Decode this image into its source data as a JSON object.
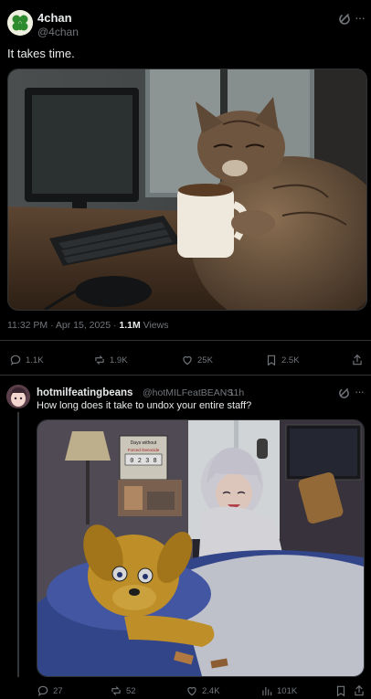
{
  "main_tweet": {
    "author_name": "4chan",
    "author_handle": "@4chan",
    "text": "It takes time.",
    "timestamp": "11:32 PM · Apr 15, 2025 · ",
    "views_count": "1.1M",
    "views_label": " Views",
    "actions": {
      "replies": "1.1K",
      "reposts": "1.9K",
      "likes": "25K",
      "bookmarks": "2.5K"
    },
    "avatar_icon": "clover-icon",
    "menu_icons": [
      "grok-icon",
      "more-icon"
    ]
  },
  "reply_tweet": {
    "author_name": "hotmilfeatingbeans",
    "author_handle": "@hotMILFeatBEANS",
    "time_ago": "· 11h",
    "text": "How long does it take to undox your entire staff?",
    "sign_title": "Days without",
    "sign_subtitle": "Forced Genocide",
    "sign_counter": "0 2 3 8",
    "actions": {
      "replies": "27",
      "reposts": "52",
      "likes": "2.4K",
      "views": "101K"
    }
  },
  "colors": {
    "background": "#000000",
    "text": "#e7e9ea",
    "muted": "#71767b",
    "divider": "#2f3336"
  }
}
